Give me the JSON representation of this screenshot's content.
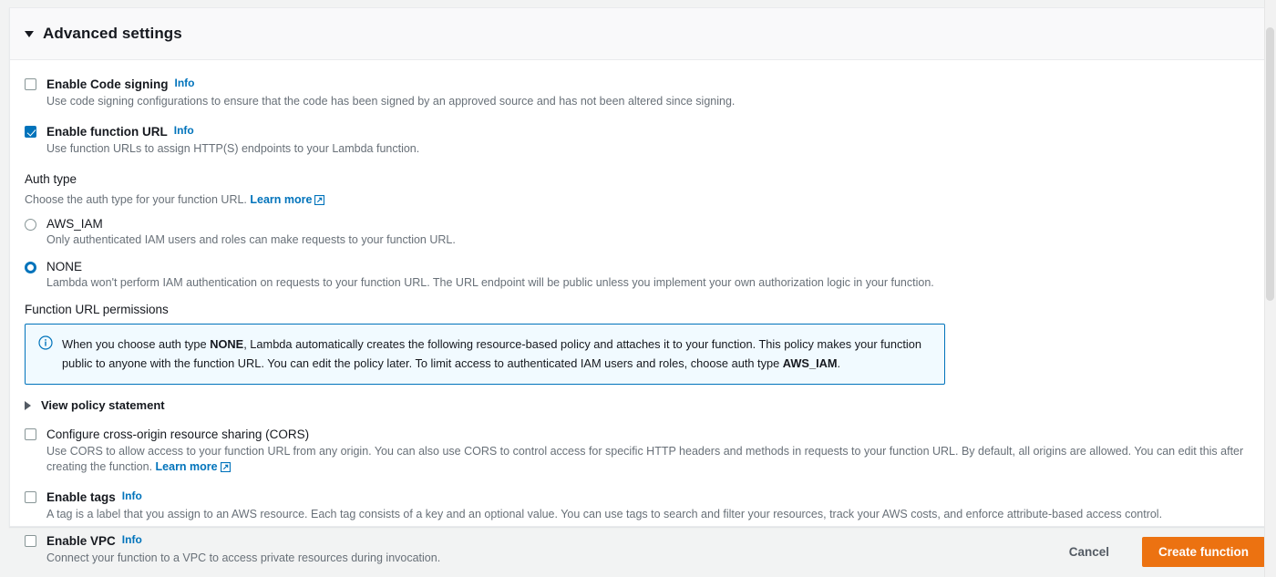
{
  "panel": {
    "title": "Advanced settings",
    "expanded_caret": "caret-down-icon"
  },
  "code_signing": {
    "label": "Enable Code signing",
    "info_label": "Info",
    "checked": false,
    "description": "Use code signing configurations to ensure that the code has been signed by an approved source and has not been altered since signing."
  },
  "function_url": {
    "label": "Enable function URL",
    "info_label": "Info",
    "checked": true,
    "description": "Use function URLs to assign HTTP(S) endpoints to your Lambda function."
  },
  "auth_type": {
    "label": "Auth type",
    "description": "Choose the auth type for your function URL.",
    "learn_more": "Learn more",
    "options": [
      {
        "value": "AWS_IAM",
        "label": "AWS_IAM",
        "selected": false,
        "description": "Only authenticated IAM users and roles can make requests to your function URL."
      },
      {
        "value": "NONE",
        "label": "NONE",
        "selected": true,
        "description": "Lambda won't perform IAM authentication on requests to your function URL. The URL endpoint will be public unless you implement your own authorization logic in your function."
      }
    ]
  },
  "permissions": {
    "label": "Function URL permissions",
    "alert": {
      "icon": "info-circle-icon",
      "part1": "When you choose auth type ",
      "bold1": "NONE",
      "part2": ", Lambda automatically creates the following resource-based policy and attaches it to your function. This policy makes your function public to anyone with the function URL. You can edit the policy later. To limit access to authenticated IAM users and roles, choose auth type ",
      "bold2": "AWS_IAM",
      "part3": "."
    },
    "view_policy_statement": "View policy statement"
  },
  "cors": {
    "label": "Configure cross-origin resource sharing (CORS)",
    "checked": false,
    "description": "Use CORS to allow access to your function URL from any origin. You can also use CORS to control access for specific HTTP headers and methods in requests to your function URL. By default, all origins are allowed. You can edit this after creating the function.",
    "learn_more": "Learn more"
  },
  "tags": {
    "label": "Enable tags",
    "info_label": "Info",
    "checked": false,
    "description": "A tag is a label that you assign to an AWS resource. Each tag consists of a key and an optional value. You can use tags to search and filter your resources, track your AWS costs, and enforce attribute-based access control."
  },
  "vpc": {
    "label": "Enable VPC",
    "info_label": "Info",
    "checked": false,
    "description": "Connect your function to a VPC to access private resources during invocation."
  },
  "footer": {
    "cancel_label": "Cancel",
    "create_label": "Create function",
    "primary_color": "#ec7211"
  },
  "colors": {
    "accent_blue": "#0073bb",
    "text": "#16191f",
    "muted": "#687078",
    "alert_bg": "#f1faff"
  }
}
